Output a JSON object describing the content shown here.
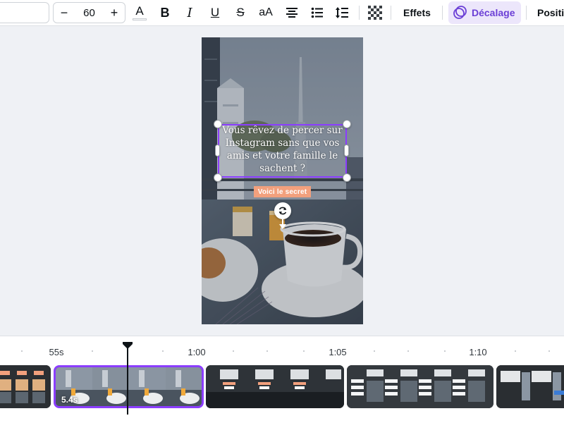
{
  "toolbar": {
    "font_size": "60",
    "decrease_label": "−",
    "increase_label": "+",
    "text_color_letter": "A",
    "bold_letter": "B",
    "italic_letter": "I",
    "underline_letter": "U",
    "strike_letter": "S",
    "case_label": "aA",
    "effects_label": "Effets",
    "offset_label": "Décalage",
    "position_label": "Positi",
    "accent_color": "#8b3dff"
  },
  "canvas": {
    "caption": "Vous rêvez de percer sur Instagram sans que vos amis et votre famille le sachent ?",
    "tag_text": "Voici le secret",
    "tag_color": "#f2a07d"
  },
  "timeline": {
    "time_labels": [
      "55s",
      "1:00",
      "1:05",
      "1:10"
    ],
    "selected_clip_duration": "5.4s"
  }
}
